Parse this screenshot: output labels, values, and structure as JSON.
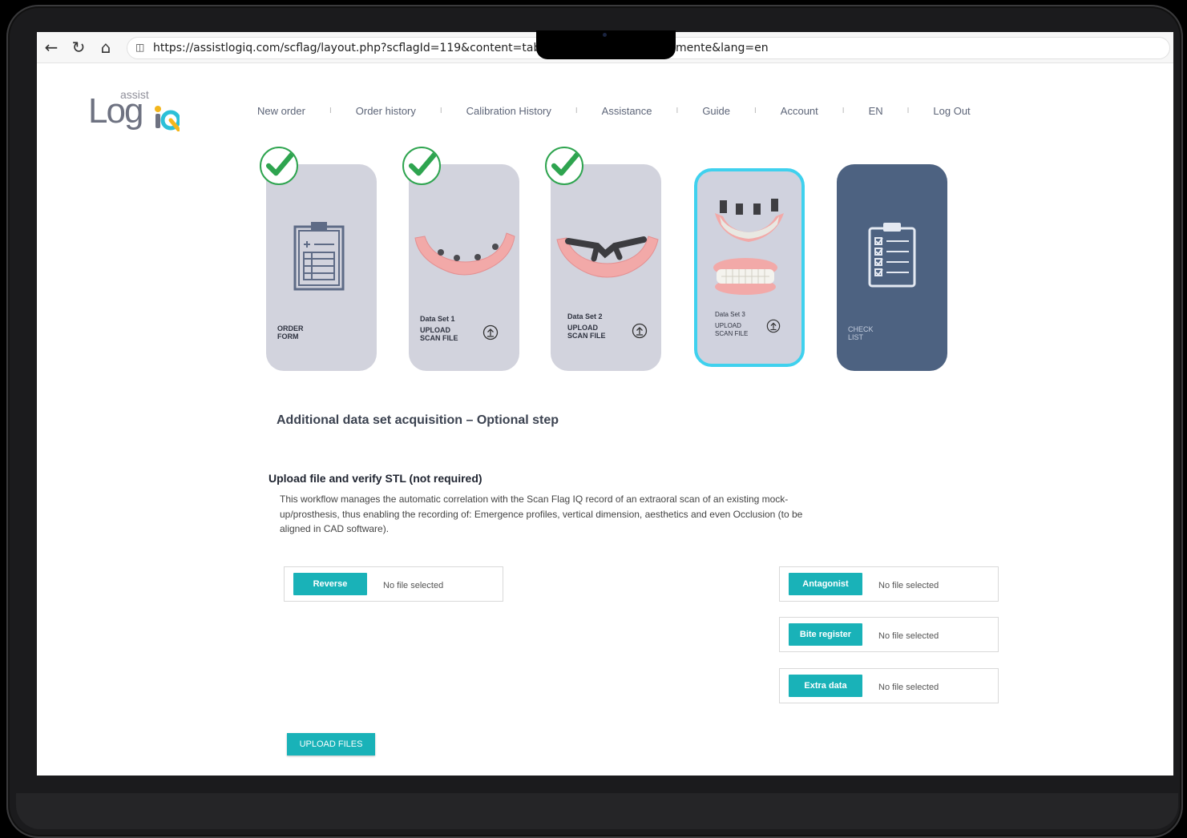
{
  "browser": {
    "url": "https://assistlogiq.com/scflag/layout.php?scflagId=119&content=tab1&msg=",
    "url_tail": "mente&lang=en"
  },
  "logo": {
    "small_text": "assist",
    "main_text": "Log"
  },
  "nav": {
    "items": [
      "New order",
      "Order history",
      "Calibration History",
      "Assistance",
      "Guide",
      "Account",
      "EN",
      "Log Out"
    ],
    "separator": "I"
  },
  "steps": [
    {
      "line1": "ORDER",
      "line2": "FORM",
      "completed": true
    },
    {
      "set": "Data Set 1",
      "line1": "UPLOAD",
      "line2": "SCAN FILE",
      "completed": true
    },
    {
      "set": "Data Set 2",
      "line1": "UPLOAD",
      "line2": "SCAN FILE",
      "completed": true
    },
    {
      "set": "Data Set 3",
      "line1": "UPLOAD",
      "line2": "SCAN FILE",
      "active": true
    },
    {
      "line1": "CHECK",
      "line2": "LIST"
    }
  ],
  "main": {
    "title": "Additional data set acquisition – Optional step",
    "subtitle": "Upload file and verify STL (not required)",
    "description": "This workflow manages the automatic correlation with the Scan Flag IQ record of an extraoral scan of an existing mock-up/prosthesis, thus enabling the recording of: Emergence profiles, vertical dimension, aesthetics and even Occlusion (to be aligned in CAD software)."
  },
  "files": {
    "reverse": {
      "label": "Reverse",
      "status": "No file selected"
    },
    "antagonist": {
      "label": "Antagonist",
      "status": "No file selected"
    },
    "bite": {
      "label": "Bite register",
      "status": "No file selected"
    },
    "extra": {
      "label": "Extra data",
      "status": "No file selected"
    }
  },
  "upload_button": "UPLOAD FILES",
  "colors": {
    "accent": "#19b2b8",
    "active_border": "#3fd1ee",
    "card_bg": "#d2d3dd",
    "card_dark": "#4d6281",
    "check_green": "#2ea44f"
  }
}
